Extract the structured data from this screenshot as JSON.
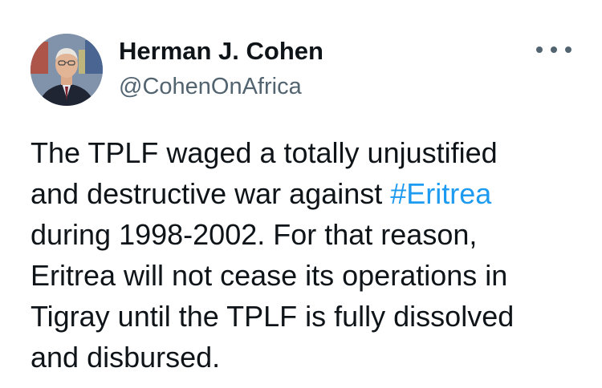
{
  "author": {
    "display_name": "Herman J. Cohen",
    "handle": "@CohenOnAfrica",
    "avatar_icon": "profile-photo"
  },
  "menu": {
    "icon": "more-options-icon"
  },
  "tweet": {
    "lines": [
      {
        "text": "The TPLF waged a totally unjustified"
      },
      {
        "before": "and destructive war against ",
        "hashtag": "#Eritrea"
      },
      {
        "text": "during 1998-2002.  For that reason,"
      },
      {
        "text": "Eritrea will not cease its operations in"
      },
      {
        "text": "Tigray until the TPLF is fully dissolved"
      },
      {
        "text": "and disbursed."
      }
    ]
  },
  "colors": {
    "text": "#0f1419",
    "secondary": "#536471",
    "link": "#1d9bf0",
    "background": "#ffffff"
  }
}
